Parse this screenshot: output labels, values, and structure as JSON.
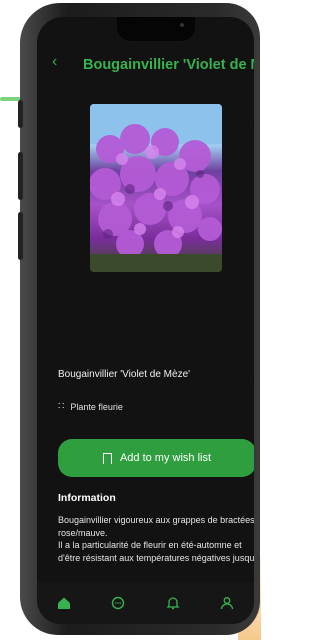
{
  "header": {
    "back_icon": "chevron-left-icon",
    "title": "Bougainvillier 'Violet de Mèze'"
  },
  "plant": {
    "name": "Bougainvillier 'Violet de Mèze'",
    "category_icon": "grid-icon",
    "category": "Plante fleurie"
  },
  "actions": {
    "wishlist_icon": "bookmark-icon",
    "wishlist_label": "Add to my wish list"
  },
  "information": {
    "heading": "Information",
    "lines": [
      "Bougainvillier vigoureux aux grappes de bractées rose/mauve.",
      "Il a la particularité de fleurir en été-automne et d'être résistant aux températures négatives jusqu'"
    ]
  },
  "bottom_nav": {
    "items": [
      {
        "icon": "home-icon",
        "active": true
      },
      {
        "icon": "chat-icon",
        "active": false
      },
      {
        "icon": "bell-icon",
        "active": false
      },
      {
        "icon": "user-icon",
        "active": false
      }
    ]
  },
  "colors": {
    "accent": "#37b24d",
    "button": "#2e9e3f",
    "background": "#121212"
  }
}
